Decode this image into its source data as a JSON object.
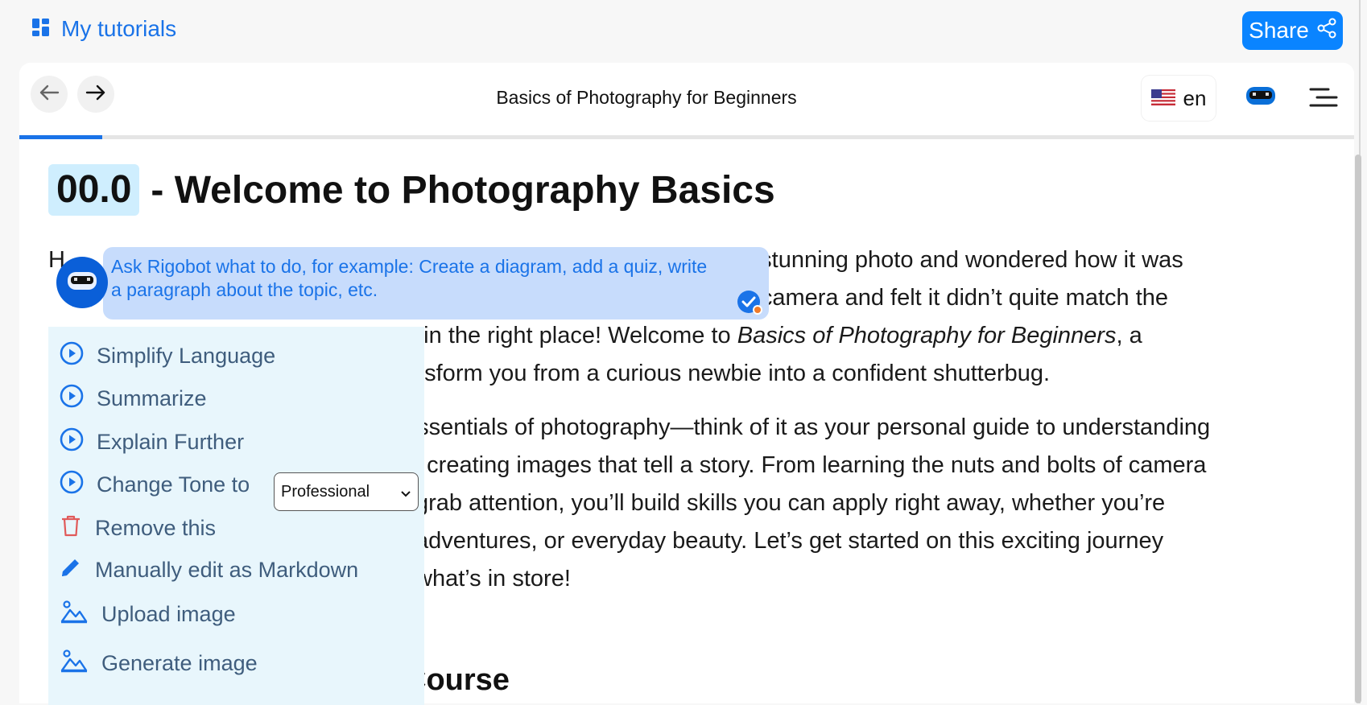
{
  "header": {
    "my_tutorials_label": "My tutorials",
    "share_label": "Share"
  },
  "navbar": {
    "title": "Basics of Photography for Beginners",
    "language": "en",
    "progress_fraction": 0.062
  },
  "lesson": {
    "number": "00.0",
    "title": "- Welcome to Photography Basics",
    "paragraph1": [
      "H",
      "a stunning photo and wondered how it was",
      "or camera and felt it didn’t quite match the",
      "e in the right place! Welcome to ",
      "Basics of Photography for Beginners",
      ", a",
      "nsform you from a curious newbie into a confident shutterbug."
    ],
    "paragraph2": [
      "essentials of photography—think of it as your personal guide to understanding",
      "d creating images that tell a story. From learning the nuts and bolts of camera",
      "grab attention, you’ll build skills you can apply right away, whether you’re",
      "adventures, or everyday beauty. Let’s get started on this exciting journey",
      "what’s in store!"
    ],
    "section_heading": "Course"
  },
  "rigobot": {
    "prompt_placeholder": "Ask Rigobot what to do, for example: Create a diagram, add a quiz, write a paragraph about the topic, etc.",
    "actions": {
      "simplify": "Simplify Language",
      "summarize": "Summarize",
      "explain": "Explain Further",
      "change_tone": "Change Tone to",
      "tone_selected": "Professional",
      "remove": "Remove this",
      "edit_markdown": "Manually edit as Markdown",
      "upload_image": "Upload image",
      "generate_image": "Generate image"
    }
  },
  "colors": {
    "accent": "#1a73e8",
    "share_button": "#0a84ff",
    "prompt_bg": "#c7dcfc",
    "menu_bg": "#e8f6fc",
    "number_badge_bg": "#cfeefe",
    "remove_icon": "#e05a5a"
  },
  "icons": [
    "dashboard-icon",
    "share-icon",
    "arrow-left-icon",
    "arrow-right-icon",
    "us-flag-icon",
    "rigobot-icon",
    "menu-icon",
    "send-check-icon",
    "play-circle-icon",
    "trash-icon",
    "pencil-icon",
    "image-icon",
    "chevron-down-icon"
  ]
}
